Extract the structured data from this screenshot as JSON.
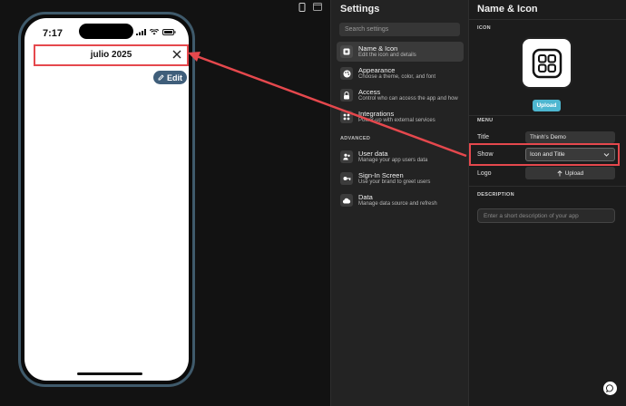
{
  "phone": {
    "status_time": "7:17",
    "app_title": "julio 2025",
    "edit_label": "Edit"
  },
  "settings": {
    "title": "Settings",
    "search_placeholder": "Search settings",
    "items": [
      {
        "label": "Name & Icon",
        "desc": "Edit the icon and details",
        "icon": "app-icon"
      },
      {
        "label": "Appearance",
        "desc": "Choose a theme, color, and font",
        "icon": "palette-icon"
      },
      {
        "label": "Access",
        "desc": "Control who can access the app and how",
        "icon": "lock-icon"
      },
      {
        "label": "Integrations",
        "desc": "Power-up with external services",
        "icon": "grid-icon"
      }
    ],
    "advanced_heading": "ADVANCED",
    "advanced_items": [
      {
        "label": "User data",
        "desc": "Manage your app users data",
        "icon": "users-icon"
      },
      {
        "label": "Sign-In Screen",
        "desc": "Use your brand to greet users",
        "icon": "key-icon"
      },
      {
        "label": "Data",
        "desc": "Manage data source and refresh",
        "icon": "cloud-icon"
      }
    ]
  },
  "props": {
    "title": "Name & Icon",
    "icon_section": "ICON",
    "upload_label": "Upload",
    "menu_section": "MENU",
    "title_label": "Title",
    "title_value": "Thinh's Demo",
    "show_label": "Show",
    "show_value": "Icon and Title",
    "logo_label": "Logo",
    "logo_upload_label": "Upload",
    "description_section": "DESCRIPTION",
    "description_placeholder": "Enter a short description of your app"
  },
  "colors": {
    "highlight": "#e5484d",
    "upload_accent": "#4db6d0",
    "edit_button": "#3f5e7a"
  }
}
